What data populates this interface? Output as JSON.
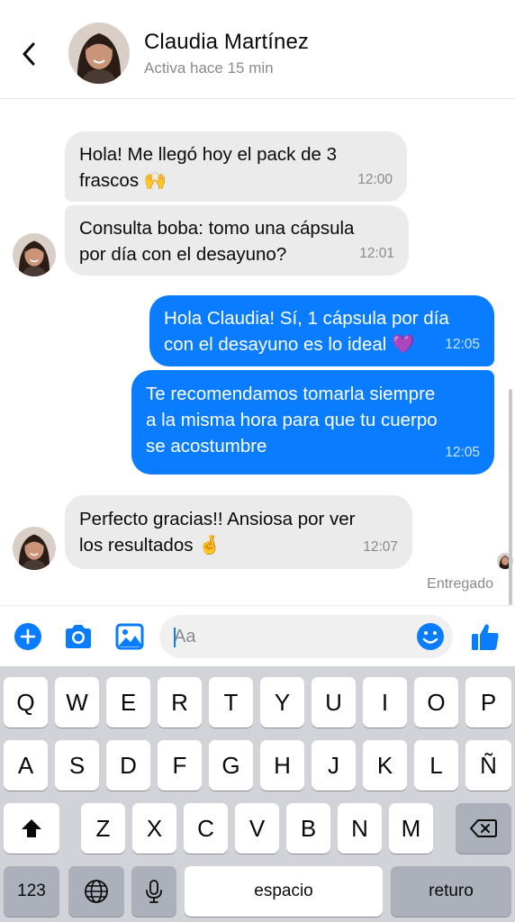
{
  "header": {
    "contact_name": "Claudia Martínez",
    "status": "Activa hace 15 min"
  },
  "messages": [
    {
      "direction": "incoming",
      "text": "Hola! Me llegó hoy el pack de 3\nfrascos 🙌",
      "time": "12:00"
    },
    {
      "direction": "incoming",
      "text": "Consulta boba: tomo una cápsula\npor día con el desayuno?",
      "time": "12:01"
    },
    {
      "direction": "outgoing",
      "text": "Hola Claudia! Sí, 1 cápsula por día\ncon el desayuno es lo ideal 💜",
      "time": "12:05"
    },
    {
      "direction": "outgoing",
      "text": "Te recomendamos tomarla siempre\na la misma hora para que tu cuerpo\nse acostumbre",
      "time": "12:05"
    },
    {
      "direction": "incoming",
      "text": "Perfecto gracias!! Ansiosa por ver\nlos resultados 🤞",
      "time": "12:07"
    }
  ],
  "delivery_status": "Entregado",
  "composer": {
    "placeholder": "Aa",
    "icons": [
      "plus-icon",
      "camera-icon",
      "image-icon",
      "emoji-icon",
      "thumbs-up-icon"
    ]
  },
  "keyboard": {
    "row1": [
      "Q",
      "W",
      "E",
      "R",
      "T",
      "Y",
      "U",
      "I",
      "O",
      "P"
    ],
    "row2": [
      "A",
      "S",
      "D",
      "F",
      "G",
      "H",
      "J",
      "K",
      "L",
      "Ñ"
    ],
    "row3": [
      "Z",
      "X",
      "C",
      "V",
      "B",
      "N",
      "M"
    ],
    "numbers_label": "123",
    "space_label": "espacio",
    "return_label": "returo"
  },
  "colors": {
    "accent": "#0a7cff",
    "incoming_bubble": "#ebebeb",
    "keyboard_bg": "#d1d3d9"
  }
}
